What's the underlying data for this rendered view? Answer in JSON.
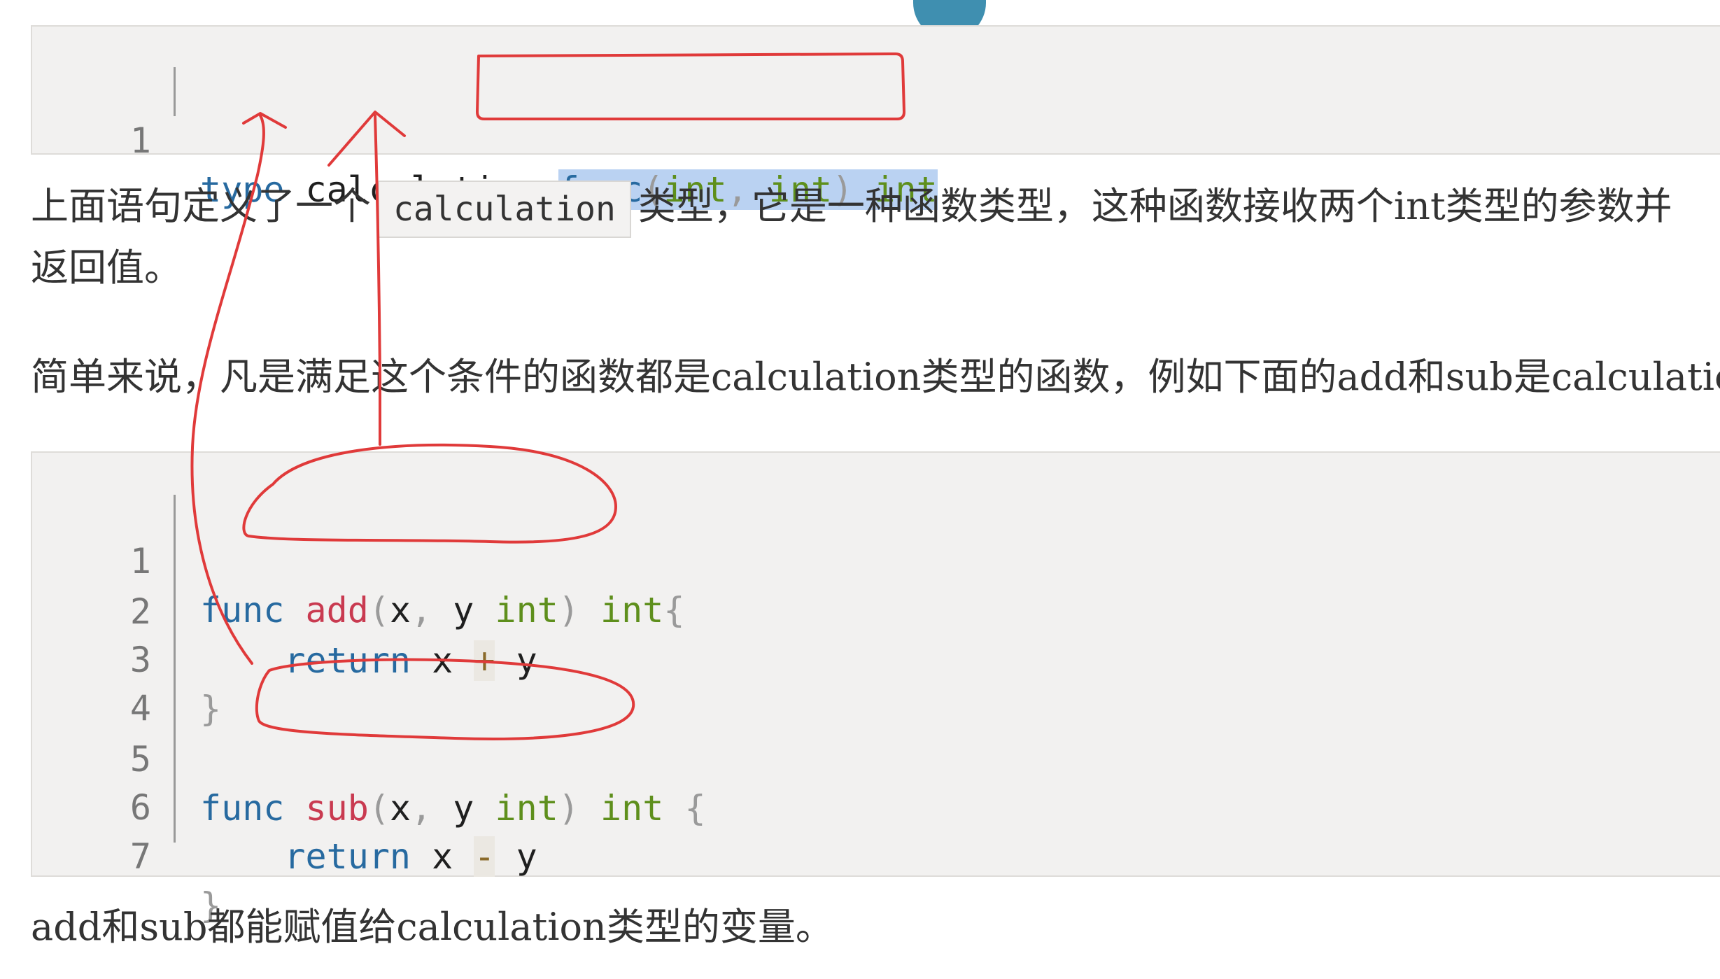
{
  "code_block_1": {
    "lines": [
      {
        "num": "1",
        "kw": "type",
        "name": "calculation",
        "sig_func": "func",
        "sig_open": "(",
        "sig_int1": "int",
        "sig_comma": ",",
        "sig_int2": "int",
        "sig_close": ")",
        "sig_ret": "int"
      }
    ]
  },
  "para_1": {
    "before": "上面语句定义了一个",
    "inline_code": "calculation",
    "after": "类型，它是一种函数类型，这种函数接收两个int类型的参数并",
    "line2": "返回值。"
  },
  "para_2": {
    "text": "简单来说，凡是满足这个条件的函数都是calculation类型的函数，例如下面的add和sub是calculation类"
  },
  "code_block_2": {
    "line_numbers": [
      "1",
      "2",
      "3",
      "4",
      "5",
      "6",
      "7"
    ],
    "kw_func": "func",
    "add_name": "add",
    "sub_name": "sub",
    "params_open": "(",
    "x": "x",
    "comma": ",",
    "y": "y",
    "int": "int",
    "params_close": ")",
    "brace_open": "{",
    "brace_close": "}",
    "kw_return": "return",
    "plus": "+",
    "minus": "-"
  },
  "para_3": {
    "text": "add和sub都能赋值给calculation类型的变量。"
  },
  "annotation_color": "#e03a3a",
  "selection_color": "#bad2f2"
}
